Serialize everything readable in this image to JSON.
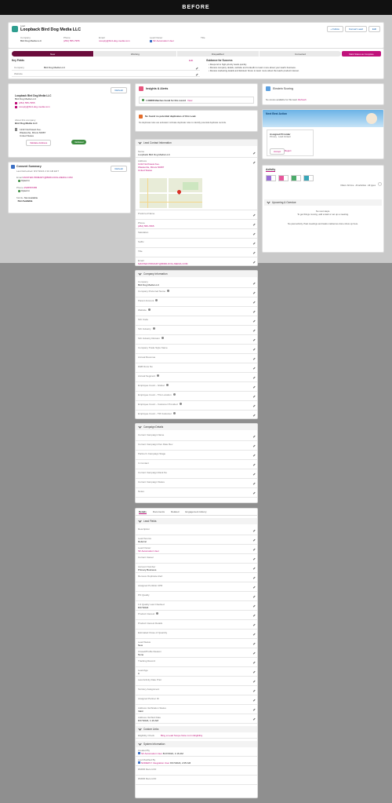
{
  "banner": {
    "label": "BEFORE"
  },
  "header": {
    "object_type": "Lead",
    "title": "Loopback Bird Dog Media LLC",
    "actions": [
      "+ Follow",
      "Convert Lead",
      "Edit"
    ],
    "company_label": "Company",
    "company_value": "Bird Dog Media LLC",
    "phone_label": "Phone",
    "phone_value": "(252) 555-7955",
    "email_label": "Email",
    "email_value": "noreply@bird-dog-media.com",
    "owner_label": "Lead Owner",
    "owner_value": "SF Automation User",
    "title_label": "Title",
    "title_value": ""
  },
  "path": {
    "steps": [
      "New",
      "Working",
      "Disqualified",
      "Converted"
    ],
    "action": "Mark Status as Complete"
  },
  "key_fields": {
    "heading": "Key Fields",
    "edit": "Edit",
    "company_label": "Company",
    "company_value": "Bird Dog Media LLC",
    "website_label": "Website",
    "website_value": ""
  },
  "guidance": {
    "heading": "Guidance for Success",
    "bullets": [
      "Respond to high-priority leads quickly.",
      "Review company details, website and LinkedIn to learn more about your lead's business.",
      "Review marketing details and Einstein Score to learn more about the lead's product interest."
    ]
  },
  "contact_card": {
    "refresh": "Refresh",
    "name": "Loopback Bird Dog Media LLC",
    "company": "Bird Dog Media LLC",
    "phone": "(252) 555-7955",
    "email": "noreply@bird-dog-media.com",
    "about_label": "About this company",
    "company_name": "Bird Dog Media LLC",
    "address": [
      "1242 Northwest Ave.",
      "Waukesha, Illinois 60087",
      "United States"
    ],
    "validate_button": "Validate Address",
    "validated_badge": "Validated"
  },
  "consent": {
    "heading": "Consent Summary",
    "refresh": "Refresh",
    "last_refreshed": "Last Refreshed: 8/17/2024 2:10 AM EDT",
    "email_label": "Email",
    "email_value": "MASTER.PRIMARY@BIRD-DOG-MEDIA.COM",
    "email_consent": "Opted in",
    "phone_label": "Phone",
    "phone_value": "2525557955",
    "phone_consent": "Opted in",
    "mobile_label": "Mobile",
    "mobile_value": "Not Available",
    "mobile_consent": "Not Available"
  },
  "insights": {
    "heading": "Insights & Alerts",
    "item1": "1 DMRR Matches found for this record",
    "item1_action": "View",
    "alert_title": "No found no potential duplicates of this Lead.",
    "alert_body": "No duplicate rules are activated. Activate duplicate rules to identify potential duplicate records."
  },
  "lead_contact_info": {
    "heading": "Lead Contact Information",
    "name_label": "Name",
    "name_value": "Loopback Bird Dog Media LLC",
    "address_label": "Address",
    "address_lines": [
      "1242 Northwest Ave.",
      "Waukesha, Illinois 60087",
      "United States"
    ],
    "preferred_label": "Preferred Name",
    "phone_label": "Phone",
    "phone_value": "(252) 555-7955",
    "salutation_label": "Salutation",
    "suffix_label": "Suffix",
    "title_label": "Title",
    "email_label": "Email",
    "email_value": "MASTER.PRIMARY@BIRD-DOG-MEDIA.COM"
  },
  "company_info": {
    "heading": "Company Information",
    "rows": [
      {
        "label": "Company",
        "value": "Bird Dog Media LLC",
        "info": false
      },
      {
        "label": "Company Preferred Name",
        "value": "",
        "info": true
      },
      {
        "label": "Parent Account",
        "value": "",
        "info": true
      },
      {
        "label": "Website",
        "value": "",
        "info": true
      },
      {
        "label": "SIC Code",
        "value": "",
        "info": false
      },
      {
        "label": "SIC Industry",
        "value": "",
        "info": true
      },
      {
        "label": "SIC Industry Division",
        "value": "",
        "info": true
      },
      {
        "label": "Company Trade Style Name",
        "value": "",
        "info": false
      },
      {
        "label": "Annual Revenue",
        "value": "",
        "info": false
      },
      {
        "label": "D&B Duns No",
        "value": "",
        "info": false
      },
      {
        "label": "Annual Segment",
        "value": "",
        "info": true
      },
      {
        "label": "Employee Count - Global",
        "value": "",
        "info": true
      },
      {
        "label": "Employee Count - This Location",
        "value": "",
        "info": true
      },
      {
        "label": "Employee Count - Customer Provided",
        "value": "",
        "info": true
      },
      {
        "label": "Employee Count - TM Customer",
        "value": "",
        "info": true
      }
    ]
  },
  "campaign_details": {
    "heading": "Campaign Details",
    "rows": [
      "Current Campaign Name",
      "Current Campaign Flex Date Rev",
      "Partner's Campaign Stage",
      "In Contact",
      "Current Campaign Rank No",
      "Current Campaign Status",
      "Notes"
    ]
  },
  "tabs": [
    "Details",
    "Documents",
    "Related",
    "Engagement History"
  ],
  "lead_fields": {
    "heading": "Lead Fields",
    "rows": [
      {
        "label": "Description",
        "value": "",
        "link": false,
        "info": false
      },
      {
        "label": "Lead Source",
        "value": "Referral",
        "link": false,
        "info": false
      },
      {
        "label": "Lead Owner",
        "value": "SF Automation User",
        "link": true,
        "info": false
      },
      {
        "label": "Current Career",
        "value": "",
        "link": false,
        "info": false
      },
      {
        "label": "Account Number",
        "value": "Primary Business",
        "link": false,
        "info": false
      },
      {
        "label": "Remove Duplicate Alert",
        "value": "",
        "link": false,
        "info": false
      },
      {
        "label": "Assigned Portfolio CPR",
        "value": "",
        "link": false,
        "info": false
      },
      {
        "label": "PO Quality",
        "value": "",
        "link": false,
        "info": false
      },
      {
        "label": "1:0 Quality Last Checked",
        "value": "8/17/2024",
        "link": false,
        "info": false
      },
      {
        "label": "Product Interest",
        "value": "",
        "link": false,
        "info": true
      },
      {
        "label": "Product Interest Details",
        "value": "",
        "link": false,
        "info": false
      },
      {
        "label": "Estimated Close of Quantity",
        "value": "",
        "link": false,
        "info": false
      },
      {
        "label": "Lead Status",
        "value": "New",
        "link": false,
        "info": false
      },
      {
        "label": "Closed/Profile Reason",
        "value": "None",
        "link": false,
        "info": false
      },
      {
        "label": "Tracking Record",
        "value": "",
        "link": false,
        "info": false
      },
      {
        "label": "Lead Age",
        "value": "0",
        "link": false,
        "info": false
      },
      {
        "label": "Last Activity Date Prior",
        "value": "",
        "link": false,
        "info": false
      },
      {
        "label": "Territory Assignment",
        "value": "",
        "link": false,
        "info": false
      },
      {
        "label": "Assigned Partner ID",
        "value": "",
        "link": false,
        "info": false
      },
      {
        "label": "Address Verification Status",
        "value": "Valid",
        "link": false,
        "info": false
      },
      {
        "label": "Address Verified Date",
        "value": "8/17/2024, 1:16 AM",
        "link": false,
        "info": false
      }
    ]
  },
  "custom_links": {
    "heading": "Custom Links",
    "label": "Eligibility Check",
    "value": "Bing a Lead Scope Note not in Eligibility"
  },
  "system_info": {
    "heading": "System Information",
    "created_label": "Created By",
    "created_user": "SF Automation User",
    "created_date": "8/17/2024, 1:16 AM",
    "modified_label": "Last Modified By",
    "modified_user": "NOREPLY Integration User",
    "modified_date": "8/17/2024, 2:05 AM",
    "dmrr_label": "DMRR Record ID",
    "dmrr_label2": "DMRR Record ID"
  },
  "einstein": {
    "heading": "Einstein Scoring",
    "body": "No scores available for this lead.",
    "link": "Refresh"
  },
  "next_best_action": {
    "heading": "Next Best Action",
    "item_title": "Assigned Provider",
    "item_sub": "Primary · Lead Contact",
    "accept": "Accept",
    "reject": "Reject"
  },
  "activity": {
    "heading": "Activity",
    "filter_text": "Filters: All time · All activities · All types",
    "upcoming": "Upcoming & Overdue",
    "no_steps": "No next steps.",
    "no_steps_sub": "To get things moving, add a task or set up a meeting.",
    "no_past": "No past activity. Past meetings and tasks marked as done show up here."
  }
}
